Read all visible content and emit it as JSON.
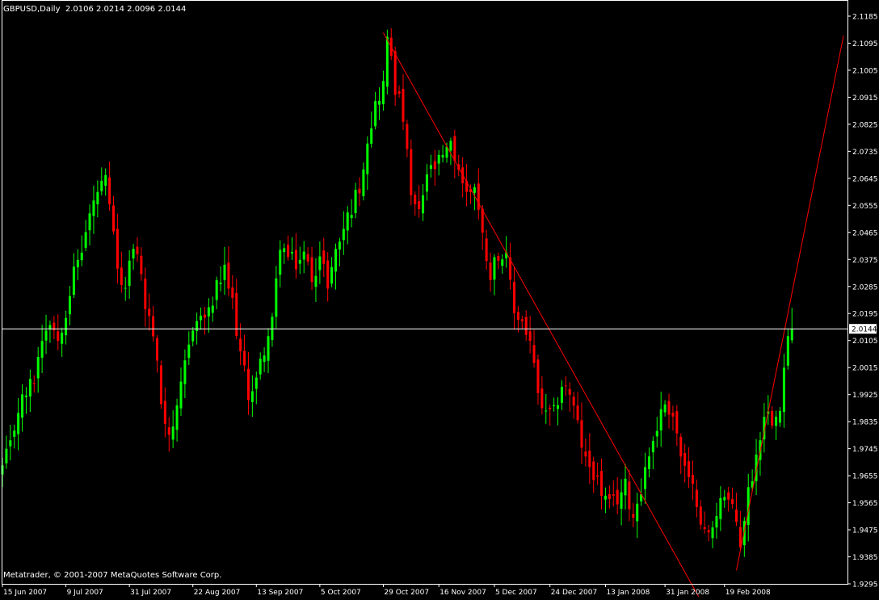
{
  "header": {
    "symbol_line": "GBPUSD,Daily  2.0106 2.0214 2.0096 2.0144"
  },
  "footer": {
    "copyright": "Metatrader, © 2001-2007 MetaQuotes Software Corp."
  },
  "colors": {
    "background": "#000000",
    "bull": "#00FF00",
    "bear": "#FF0000",
    "axis": "#FFFFFF",
    "trendline": "#FF0000",
    "price_line": "#FFFFFF",
    "label_bg": "#FFFFFF",
    "label_text": "#000000"
  },
  "chart_data": {
    "type": "candlestick",
    "symbol": "GBPUSD",
    "timeframe": "Daily",
    "current_price": 2.0144,
    "current_price_label": "2.0144",
    "y_ticks": [
      "2.1185",
      "2.1095",
      "2.1005",
      "2.0915",
      "2.0825",
      "2.0735",
      "2.0645",
      "2.0555",
      "2.0465",
      "2.0375",
      "2.0285",
      "2.0195",
      "2.0105",
      "2.0015",
      "1.9925",
      "1.9835",
      "1.9745",
      "1.9655",
      "1.9565",
      "1.9475",
      "1.9385",
      "1.9295"
    ],
    "x_ticks": [
      {
        "label": "15 Jun 2007",
        "index": 0
      },
      {
        "label": "9 Jul 2007",
        "index": 16
      },
      {
        "label": "31 Jul 2007",
        "index": 32
      },
      {
        "label": "22 Aug 2007",
        "index": 48
      },
      {
        "label": "13 Sep 2007",
        "index": 64
      },
      {
        "label": "5 Oct 2007",
        "index": 80
      },
      {
        "label": "29 Oct 2007",
        "index": 96
      },
      {
        "label": "16 Nov 2007",
        "index": 110
      },
      {
        "label": "5 Dec 2007",
        "index": 124
      },
      {
        "label": "24 Dec 2007",
        "index": 138
      },
      {
        "label": "13 Jan 2008",
        "index": 152
      },
      {
        "label": "31 Jan 2008",
        "index": 167
      },
      {
        "label": "19 Feb 2008",
        "index": 182
      }
    ],
    "ylim": [
      1.9295,
      2.1185
    ],
    "x_index_range": [
      0,
      213
    ],
    "anchors": [
      [
        0,
        1.968
      ],
      [
        2,
        1.975
      ],
      [
        4,
        1.988
      ],
      [
        6,
        1.993
      ],
      [
        8,
        1.998
      ],
      [
        10,
        2.012
      ],
      [
        12,
        2.018
      ],
      [
        14,
        2.011
      ],
      [
        16,
        2.021
      ],
      [
        18,
        2.033
      ],
      [
        20,
        2.041
      ],
      [
        22,
        2.052
      ],
      [
        24,
        2.06
      ],
      [
        26,
        2.063
      ],
      [
        28,
        2.045
      ],
      [
        30,
        2.026
      ],
      [
        32,
        2.036
      ],
      [
        34,
        2.041
      ],
      [
        36,
        2.022
      ],
      [
        38,
        2.013
      ],
      [
        40,
        1.99
      ],
      [
        42,
        1.98
      ],
      [
        44,
        1.986
      ],
      [
        46,
        2.002
      ],
      [
        48,
        2.016
      ],
      [
        50,
        2.018
      ],
      [
        52,
        2.019
      ],
      [
        54,
        2.028
      ],
      [
        56,
        2.033
      ],
      [
        58,
        2.023
      ],
      [
        60,
        2.006
      ],
      [
        62,
        1.993
      ],
      [
        64,
        1.997
      ],
      [
        66,
        2.008
      ],
      [
        68,
        2.016
      ],
      [
        70,
        2.043
      ],
      [
        72,
        2.038
      ],
      [
        74,
        2.036
      ],
      [
        76,
        2.039
      ],
      [
        78,
        2.032
      ],
      [
        80,
        2.038
      ],
      [
        82,
        2.03
      ],
      [
        84,
        2.04
      ],
      [
        86,
        2.048
      ],
      [
        88,
        2.055
      ],
      [
        90,
        2.062
      ],
      [
        92,
        2.078
      ],
      [
        94,
        2.089
      ],
      [
        96,
        2.096
      ],
      [
        97,
        2.11
      ],
      [
        98,
        2.106
      ],
      [
        99,
        2.095
      ],
      [
        101,
        2.085
      ],
      [
        103,
        2.058
      ],
      [
        105,
        2.052
      ],
      [
        107,
        2.066
      ],
      [
        109,
        2.068
      ],
      [
        111,
        2.071
      ],
      [
        113,
        2.075
      ],
      [
        115,
        2.068
      ],
      [
        117,
        2.059
      ],
      [
        119,
        2.063
      ],
      [
        121,
        2.045
      ],
      [
        123,
        2.033
      ],
      [
        125,
        2.04
      ],
      [
        127,
        2.037
      ],
      [
        129,
        2.02
      ],
      [
        131,
        2.017
      ],
      [
        133,
        2.01
      ],
      [
        135,
        1.992
      ],
      [
        137,
        1.985
      ],
      [
        139,
        1.986
      ],
      [
        141,
        1.996
      ],
      [
        143,
        1.993
      ],
      [
        145,
        1.982
      ],
      [
        147,
        1.97
      ],
      [
        149,
        1.967
      ],
      [
        151,
        1.96
      ],
      [
        153,
        1.955
      ],
      [
        155,
        1.958
      ],
      [
        157,
        1.962
      ],
      [
        159,
        1.952
      ],
      [
        161,
        1.962
      ],
      [
        163,
        1.973
      ],
      [
        165,
        1.982
      ],
      [
        167,
        1.99
      ],
      [
        169,
        1.986
      ],
      [
        171,
        1.972
      ],
      [
        173,
        1.963
      ],
      [
        175,
        1.958
      ],
      [
        177,
        1.946
      ],
      [
        179,
        1.947
      ],
      [
        181,
        1.96
      ],
      [
        183,
        1.957
      ],
      [
        185,
        1.95
      ],
      [
        186,
        1.943
      ],
      [
        188,
        1.96
      ],
      [
        190,
        1.972
      ],
      [
        192,
        1.987
      ],
      [
        194,
        1.985
      ],
      [
        196,
        1.99
      ],
      [
        198,
        2.012
      ],
      [
        199,
        2.0144
      ]
    ],
    "trendlines": [
      {
        "name": "descending",
        "points": [
          [
            96,
            2.113
          ],
          [
            176,
            1.924
          ]
        ]
      },
      {
        "name": "ascending",
        "points": [
          [
            185,
            1.934
          ],
          [
            212,
            2.112
          ]
        ]
      }
    ]
  }
}
